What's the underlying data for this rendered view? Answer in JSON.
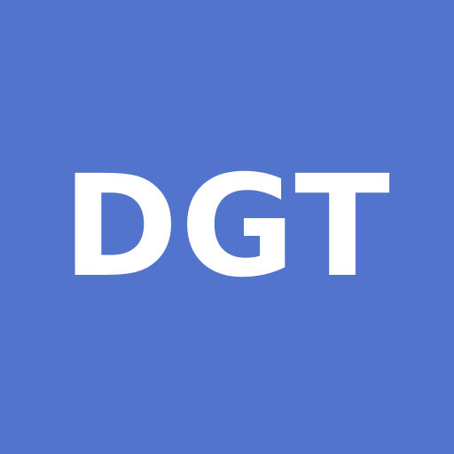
{
  "avatar": {
    "initials": "DGT",
    "background_color": "#5274cc",
    "text_color": "#ffffff"
  }
}
